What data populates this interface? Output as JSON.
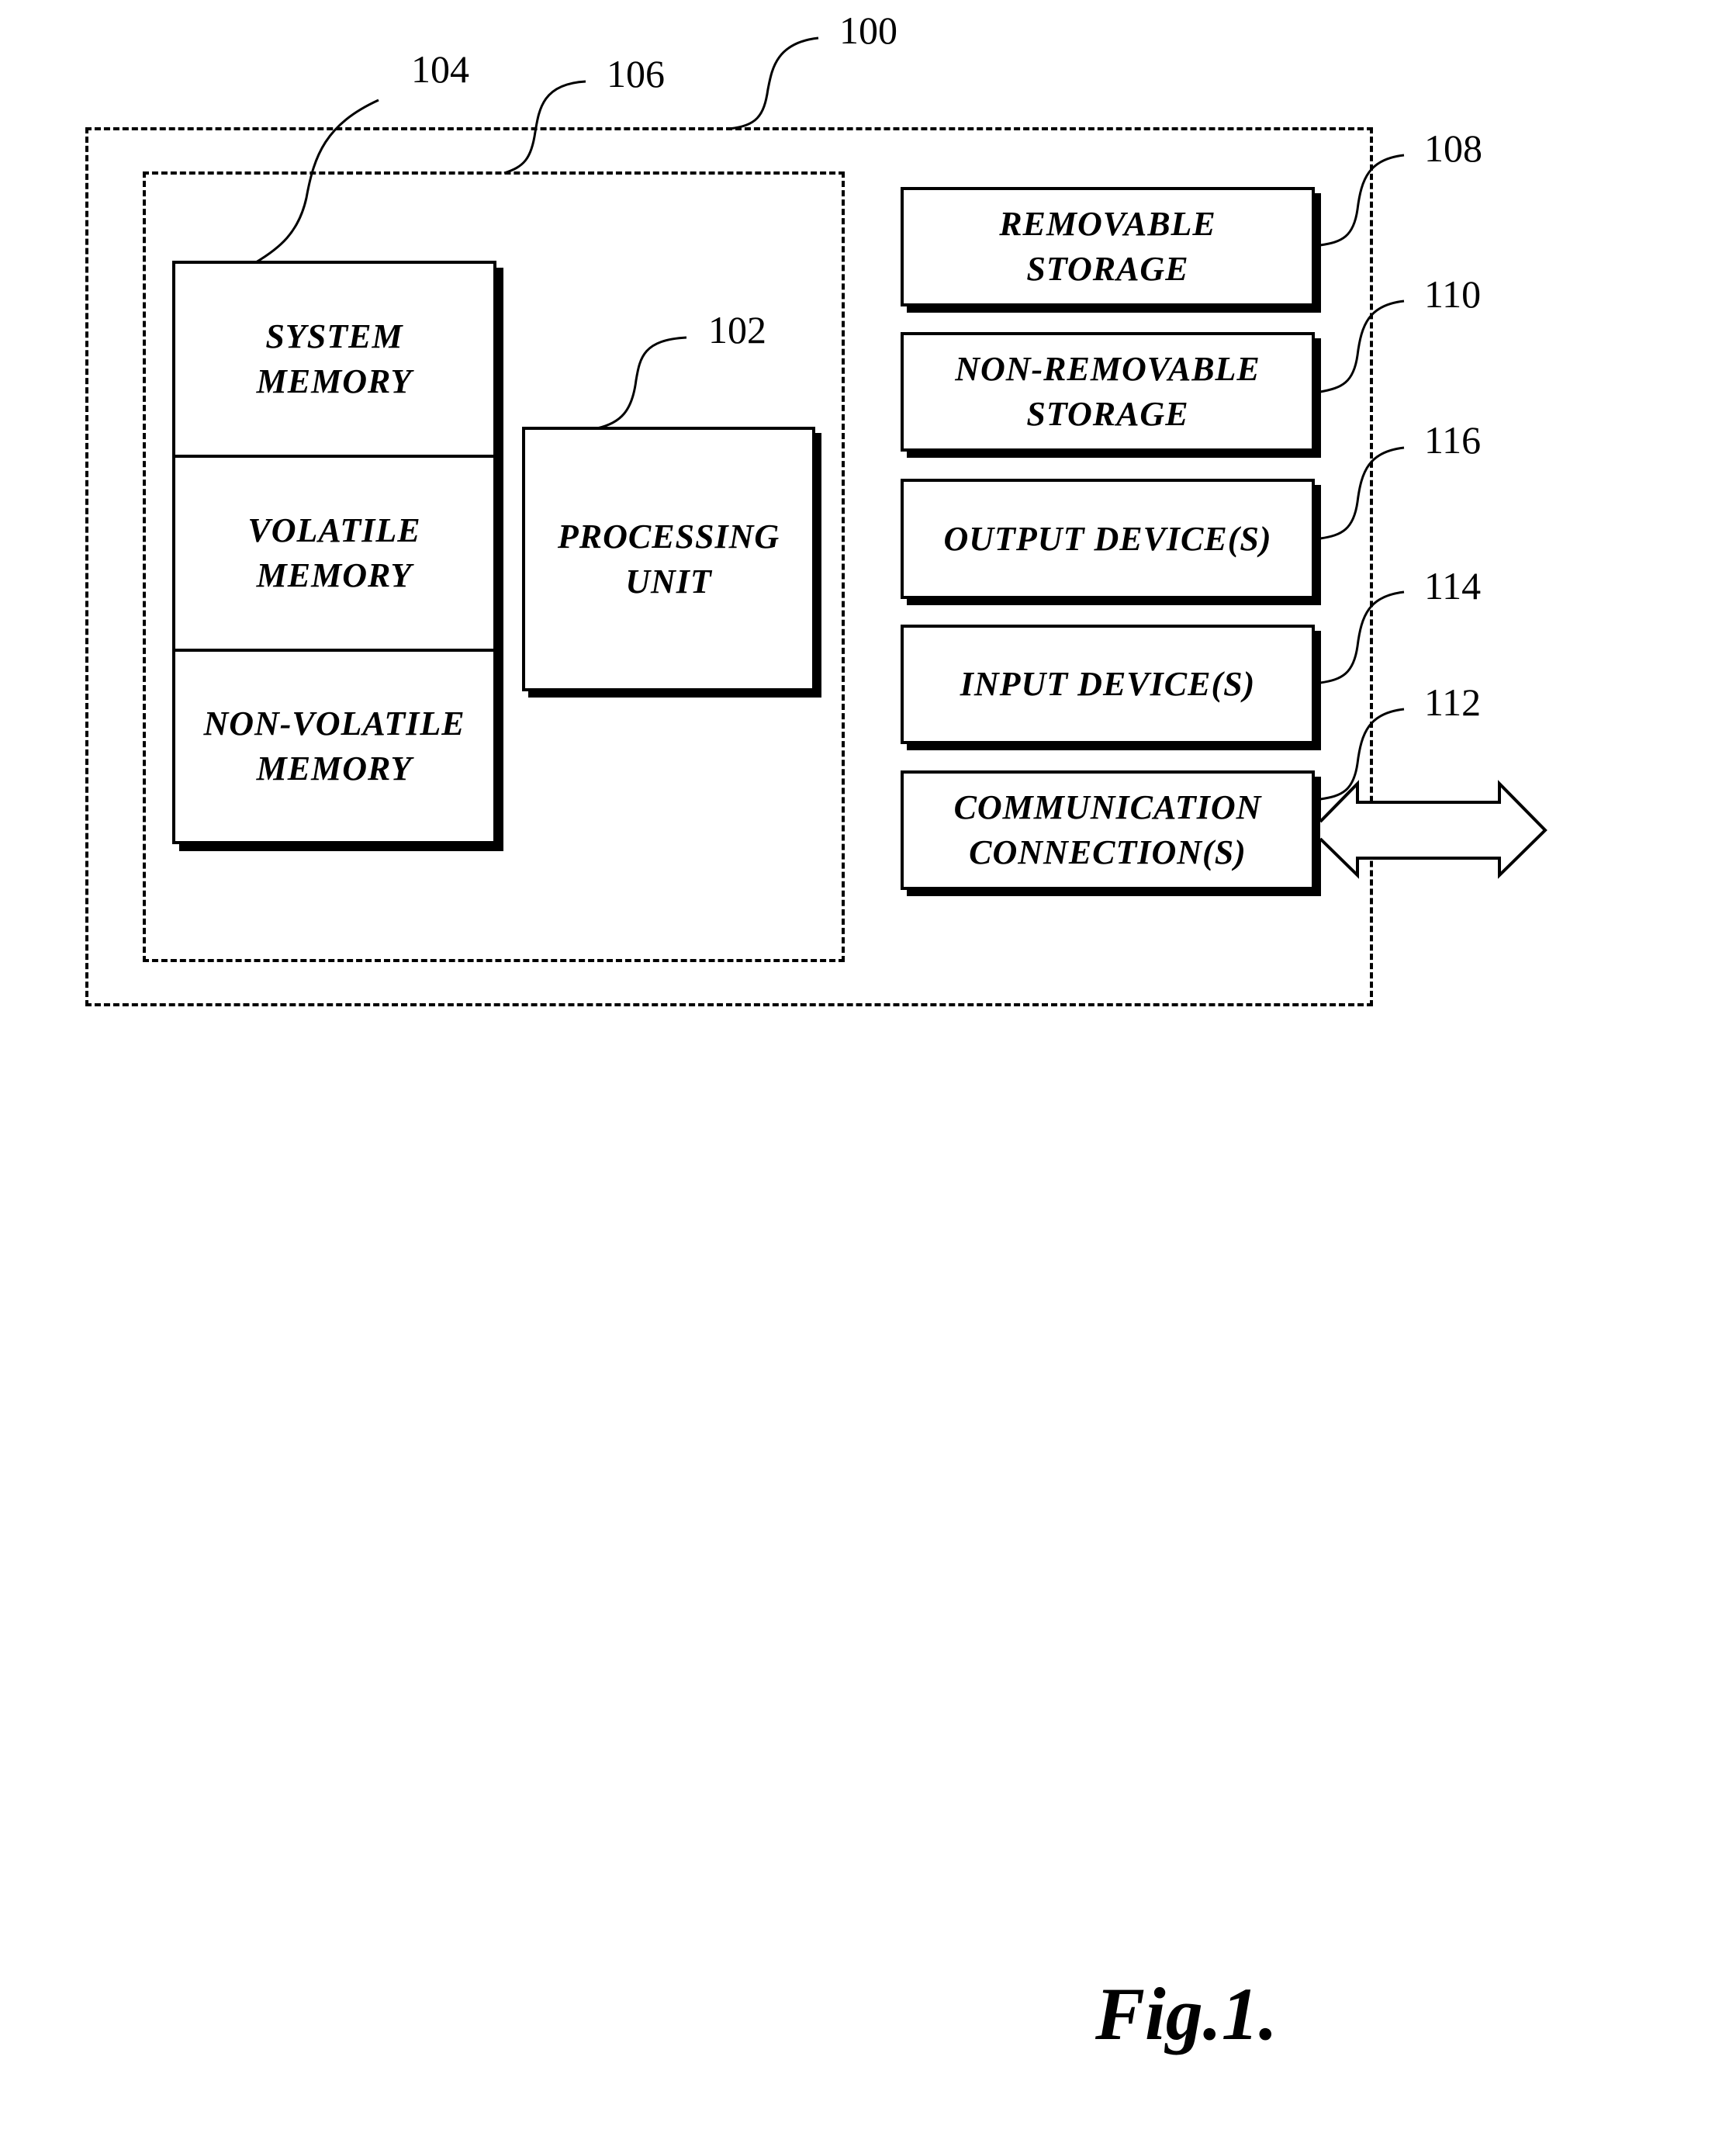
{
  "figure": {
    "caption": "Fig.1.",
    "device_ref": "100",
    "inner_group_ref": "106",
    "memory": {
      "ref": "104",
      "cells": [
        {
          "label": "SYSTEM\nMEMORY"
        },
        {
          "label": "VOLATILE\nMEMORY"
        },
        {
          "label": "NON-VOLATILE\nMEMORY"
        }
      ]
    },
    "processing_unit": {
      "ref": "102",
      "label": "PROCESSING\nUNIT"
    },
    "components": [
      {
        "ref": "108",
        "label": "REMOVABLE\nSTORAGE"
      },
      {
        "ref": "110",
        "label": "NON-REMOVABLE\nSTORAGE"
      },
      {
        "ref": "116",
        "label": "OUTPUT DEVICE(S)"
      },
      {
        "ref": "114",
        "label": "INPUT DEVICE(S)"
      },
      {
        "ref": "112",
        "label": "COMMUNICATION\nCONNECTION(S)"
      }
    ],
    "connection_arrow": "double-headed-arrow"
  }
}
